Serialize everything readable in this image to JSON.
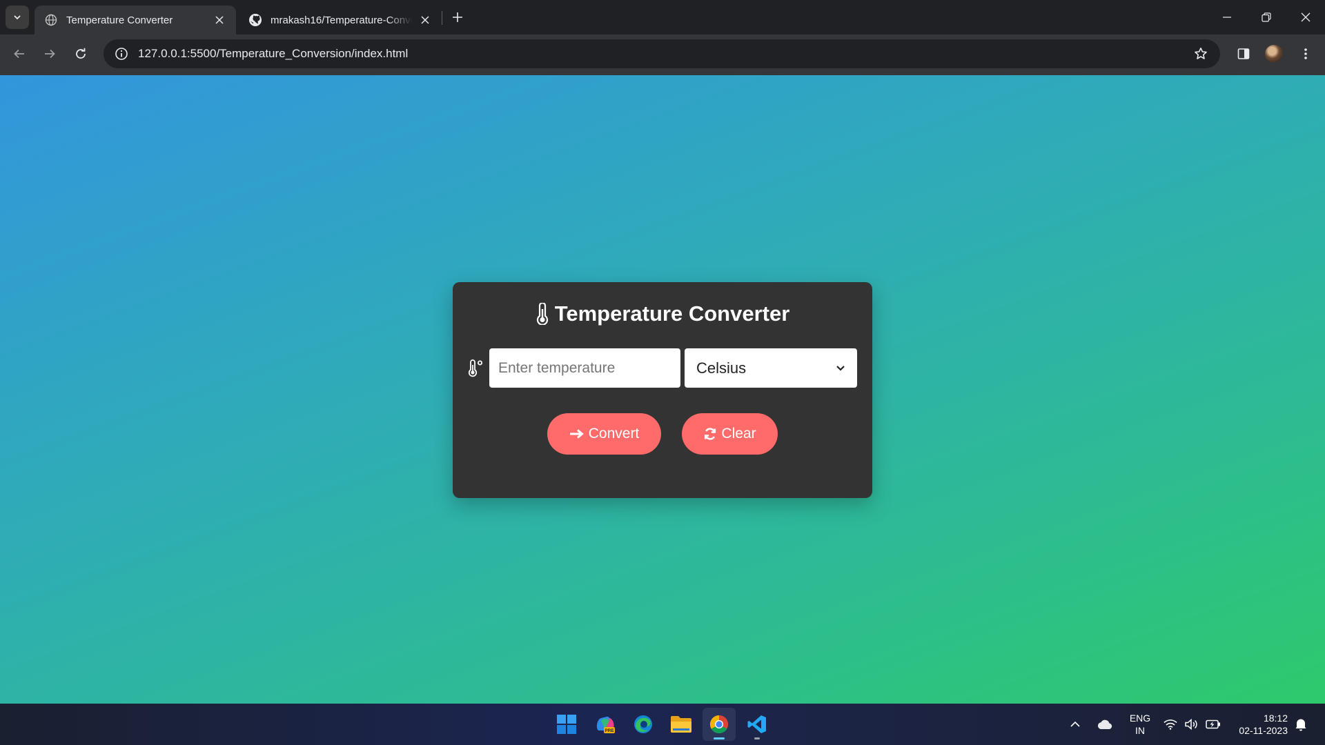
{
  "browser": {
    "tabs": [
      {
        "title": "Temperature Converter",
        "active": true,
        "icon": "globe-icon"
      },
      {
        "title": "mrakash16/Temperature-Conversion",
        "active": false,
        "icon": "github-icon"
      }
    ],
    "url": "127.0.0.1:5500/Temperature_Conversion/index.html"
  },
  "page": {
    "title": "Temperature Converter",
    "title_icon": "thermometer-icon",
    "input_placeholder": "Enter temperature",
    "input_value": "",
    "unit_selected": "Celsius",
    "convert_label": "Convert",
    "clear_label": "Clear"
  },
  "taskbar": {
    "apps": [
      "windows-start",
      "copilot-pre",
      "edge",
      "file-explorer",
      "chrome",
      "vscode"
    ],
    "language_line1": "ENG",
    "language_line2": "IN",
    "time": "18:12",
    "date": "02-11-2023"
  },
  "colors": {
    "card_bg": "#333333",
    "button_bg": "#ff6b6b",
    "gradient_start": "#3296dc",
    "gradient_end": "#2ec96c"
  }
}
